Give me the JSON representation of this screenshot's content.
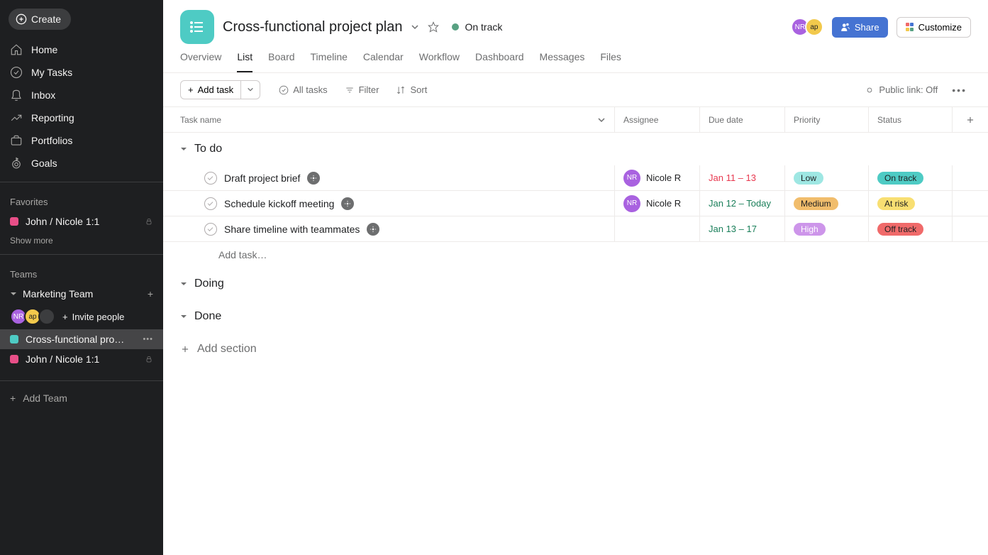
{
  "sidebar": {
    "create": "Create",
    "nav": [
      {
        "label": "Home",
        "icon": "home"
      },
      {
        "label": "My Tasks",
        "icon": "check"
      },
      {
        "label": "Inbox",
        "icon": "bell"
      },
      {
        "label": "Reporting",
        "icon": "chart"
      },
      {
        "label": "Portfolios",
        "icon": "portfolio"
      },
      {
        "label": "Goals",
        "icon": "goal"
      }
    ],
    "favorites_label": "Favorites",
    "favorites": [
      {
        "label": "John / Nicole 1:1",
        "color": "#e84f88",
        "locked": true
      }
    ],
    "show_more": "Show more",
    "teams_label": "Teams",
    "team_name": "Marketing Team",
    "team_avatars": [
      {
        "text": "NR",
        "bg": "#a962e0",
        "fg": "#fff"
      },
      {
        "text": "ap",
        "bg": "#f2c94c",
        "fg": "#1e1f21"
      },
      {
        "text": "",
        "bg": "#3c3d3f",
        "fg": "#fff"
      }
    ],
    "invite_label": "Invite people",
    "team_projects": [
      {
        "label": "Cross-functional pro…",
        "color": "#4ecbc4",
        "active": true,
        "locked": false
      },
      {
        "label": "John / Nicole 1:1",
        "color": "#e84f88",
        "active": false,
        "locked": true
      }
    ],
    "add_team": "Add Team"
  },
  "header": {
    "title": "Cross-functional project plan",
    "status": {
      "label": "On track",
      "color": "#58a182"
    },
    "avatars": [
      {
        "text": "NR",
        "bg": "#a962e0",
        "fg": "#fff"
      },
      {
        "text": "ap",
        "bg": "#f2c94c",
        "fg": "#1e1f21"
      }
    ],
    "share_label": "Share",
    "customize_label": "Customize",
    "tabs": [
      "Overview",
      "List",
      "Board",
      "Timeline",
      "Calendar",
      "Workflow",
      "Dashboard",
      "Messages",
      "Files"
    ],
    "active_tab": "List"
  },
  "toolbar": {
    "add_task": "Add task",
    "all_tasks": "All tasks",
    "filter": "Filter",
    "sort": "Sort",
    "public_link": "Public link: Off"
  },
  "columns": {
    "task": "Task name",
    "assignee": "Assignee",
    "due": "Due date",
    "priority": "Priority",
    "status": "Status"
  },
  "sections": [
    {
      "name": "To do",
      "tasks": [
        {
          "name": "Draft project brief",
          "milestone": true,
          "assignee": {
            "label": "Nicole R",
            "avatar": "NR",
            "bg": "#a962e0",
            "fg": "#fff"
          },
          "due": {
            "text": "Jan 11 – 13",
            "color": "#e8384f"
          },
          "priority": {
            "text": "Low",
            "bg": "#9ee7e3",
            "fg": "#1e1f21"
          },
          "status": {
            "text": "On track",
            "bg": "#4ecbc4",
            "fg": "#1e1f21"
          }
        },
        {
          "name": "Schedule kickoff meeting",
          "milestone": true,
          "assignee": {
            "label": "Nicole R",
            "avatar": "NR",
            "bg": "#a962e0",
            "fg": "#fff"
          },
          "due": {
            "text": "Jan 12 – Today",
            "color": "#1a7f5a"
          },
          "priority": {
            "text": "Medium",
            "bg": "#f1bd6c",
            "fg": "#1e1f21"
          },
          "status": {
            "text": "At risk",
            "bg": "#f8df72",
            "fg": "#1e1f21"
          }
        },
        {
          "name": "Share timeline with teammates",
          "milestone": true,
          "assignee": null,
          "due": {
            "text": "Jan 13 – 17",
            "color": "#1a7f5a"
          },
          "priority": {
            "text": "High",
            "bg": "#cd95ea",
            "fg": "#fff"
          },
          "status": {
            "text": "Off track",
            "bg": "#f06a6a",
            "fg": "#1e1f21"
          }
        }
      ],
      "add_task_placeholder": "Add task…"
    },
    {
      "name": "Doing",
      "tasks": []
    },
    {
      "name": "Done",
      "tasks": []
    }
  ],
  "add_section": "Add section"
}
